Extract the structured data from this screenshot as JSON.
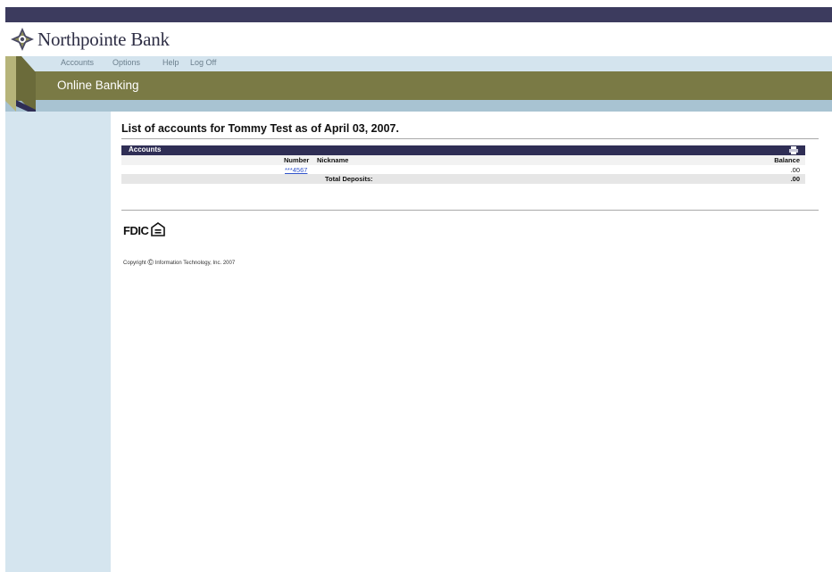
{
  "bank": {
    "name": "Northpointe Bank",
    "logo_icon": "compass-star-icon"
  },
  "nav": {
    "items": [
      "Accounts",
      "Options",
      "Help",
      "Log Off"
    ]
  },
  "banner": {
    "title": "Online Banking"
  },
  "page": {
    "title": "List of accounts for Tommy Test as of April 03, 2007."
  },
  "accounts": {
    "section_title": "Accounts",
    "print_icon": "printer-icon",
    "columns": {
      "number": "Number",
      "nickname": "Nickname",
      "balance": "Balance"
    },
    "rows": [
      {
        "number": "***4567",
        "nickname": "",
        "balance": ".00"
      }
    ],
    "total_label": "Total Deposits:",
    "total_value": ".00"
  },
  "footer": {
    "fdic": "FDIC",
    "equal_housing_icon": "equal-housing-lender-icon",
    "copyright_label": "Copyright",
    "copyright_symbol": "©",
    "copyright_text": "Information Technology, Inc. 2007"
  },
  "colors": {
    "topbar": "#3c3b5e",
    "nav": "#d4e4ee",
    "banner": "#7a7a45",
    "stripe": "#a8c3d2",
    "sidebar": "#d5e5ef",
    "table_header": "#2f2e55"
  }
}
